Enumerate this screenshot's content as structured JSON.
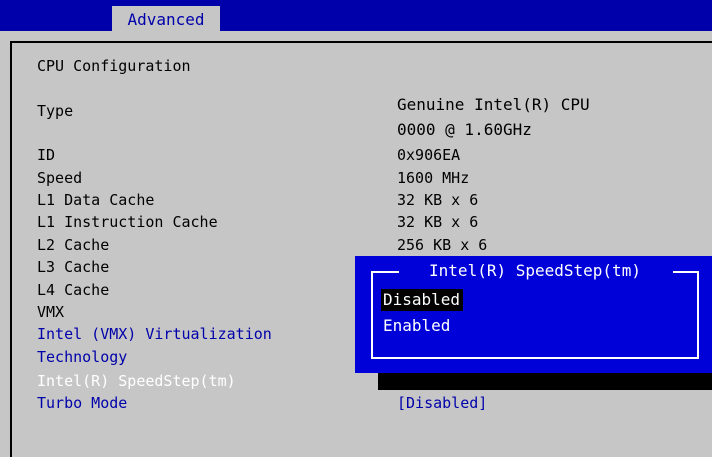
{
  "header": {
    "tab_label": "Advanced"
  },
  "main": {
    "section_title": "CPU Configuration",
    "rows": [
      {
        "label": "Type",
        "value_line1": "Genuine Intel(R) CPU",
        "value_line2": "0000 @ 1.60GHz"
      },
      {
        "label": "ID",
        "value": "0x906EA"
      },
      {
        "label": "Speed",
        "value": "1600 MHz"
      },
      {
        "label": "L1 Data Cache",
        "value": "32 KB x 6"
      },
      {
        "label": "L1 Instruction Cache",
        "value": "32 KB x 6"
      },
      {
        "label": "L2 Cache",
        "value": "256 KB x 6"
      },
      {
        "label": "L3 Cache"
      },
      {
        "label": "L4 Cache"
      },
      {
        "label": "VMX"
      }
    ],
    "settings": {
      "virtualization_label_line1": "Intel (VMX) Virtualization",
      "virtualization_label_line2": "Technology",
      "speedstep_label": "Intel(R) SpeedStep(tm)",
      "turbo_label": "Turbo Mode",
      "turbo_value": "[Disabled]"
    }
  },
  "popup": {
    "title": "Intel(R) SpeedStep(tm)",
    "options": [
      "Disabled",
      "Enabled"
    ],
    "selected": "Disabled"
  },
  "colors": {
    "background": "#c6c6c6",
    "header_blue": "#0000aa",
    "popup_blue": "#0000d8",
    "selection": "#000000"
  }
}
